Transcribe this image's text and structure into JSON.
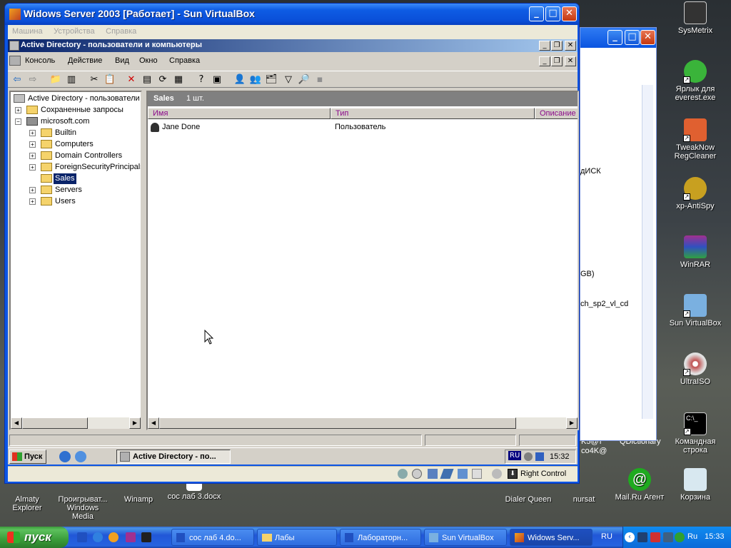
{
  "vbox": {
    "title": "Widows Server 2003 [Работает] - Sun VirtualBox",
    "menu": [
      "Машина",
      "Устройства",
      "Справка"
    ],
    "host_key": "Right Control"
  },
  "mmc": {
    "title": "Active Directory - пользователи и компьютеры",
    "menu": [
      "Консоль",
      "Действие",
      "Вид",
      "Окно",
      "Справка"
    ]
  },
  "tree": {
    "root": "Active Directory - пользователи и",
    "saved_queries": "Сохраненные запросы",
    "domain": "microsoft.com",
    "items": [
      "Builtin",
      "Computers",
      "Domain Controllers",
      "ForeignSecurityPrincipals",
      "Sales",
      "Servers",
      "Users"
    ],
    "selected": "Sales"
  },
  "list": {
    "header_name": "Sales",
    "header_count": "1 шт.",
    "columns": [
      "Имя",
      "Тип",
      "Описание"
    ],
    "rows": [
      {
        "name": "Jane Done",
        "type": "Пользователь",
        "desc": ""
      }
    ]
  },
  "guest_taskbar": {
    "start": "Пуск",
    "task": "Active Directory - по...",
    "lang": "RU",
    "clock": "15:32"
  },
  "bgwin": {
    "lines": [
      "дИСК",
      "GB)",
      "ch_sp2_vl_cd"
    ]
  },
  "desktop_right": [
    "SysMetrix",
    "Ярлык для everest.exe",
    "TweakNow RegCleaner",
    "xp-AntiSpy",
    "WinRAR",
    "Sun VirtualBox",
    "UltraISO",
    "Командная строка"
  ],
  "desktop_bottom": [
    "Almaty Explorer",
    "Проигрыват... Windows Media",
    "Winamp",
    "сос лаб 3.docx",
    "Dialer Queen",
    "nursat",
    "Mail.Ru Агент",
    "Корзина"
  ],
  "desktop_partial": [
    "QDictionary",
    "K5@т",
    "co4K@"
  ],
  "taskbar": {
    "start": "пуск",
    "items": [
      "сос лаб 4.do...",
      "Лабы",
      "Лабораторн...",
      "Sun VirtualBox",
      "Widows Serv..."
    ],
    "lang": "RU",
    "tray_lang": "Ru",
    "clock": "15:33"
  },
  "colors": {
    "xp_blue": "#0a54e0",
    "classic_title": "#0a246a",
    "start_green": "#3c9b3c"
  }
}
